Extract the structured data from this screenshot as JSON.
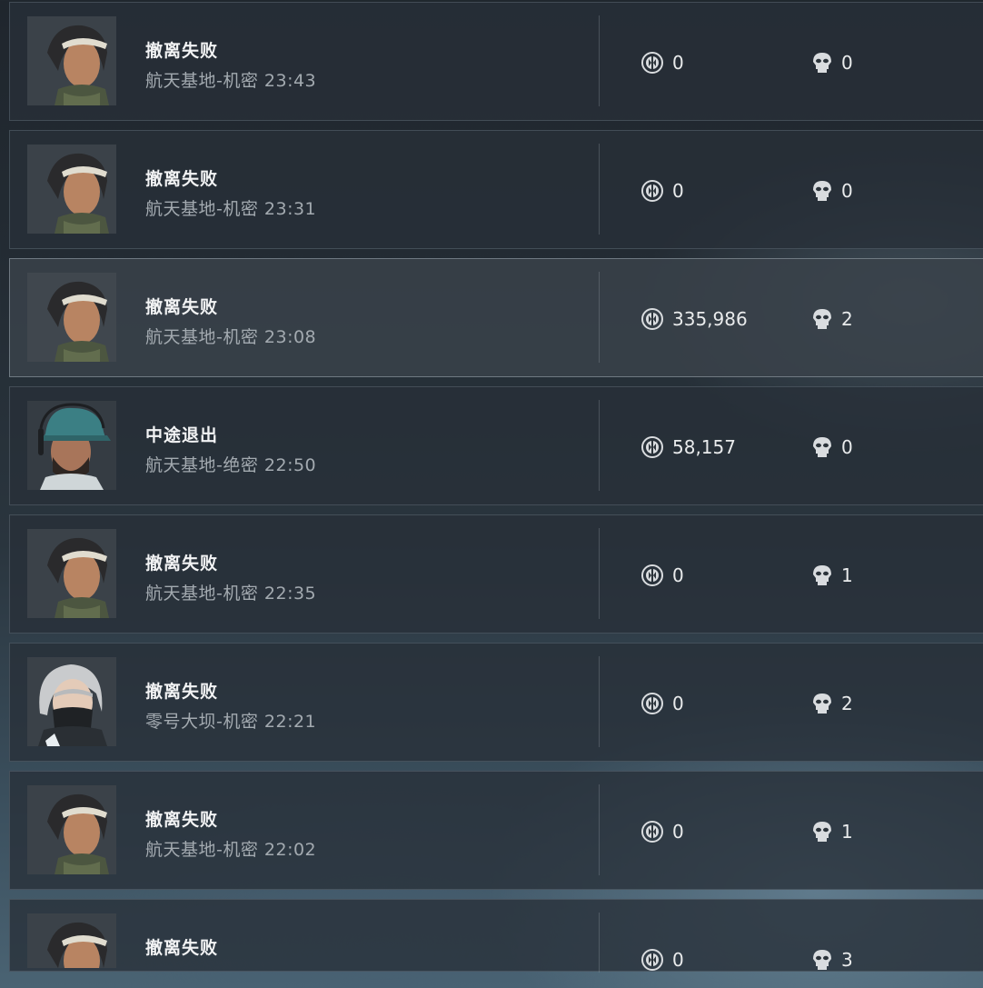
{
  "icons": {
    "currency": "hafcoin-icon",
    "kills": "skull-icon"
  },
  "colors": {
    "row_bg": "#283038",
    "row_selected_bg": "#3a424a",
    "title_text": "#f2f3f4",
    "subtitle_text": "#a3aab0"
  },
  "records": [
    {
      "operator": "female-operator-headband",
      "result": "撤离失败",
      "detail": "航天基地-机密 23:43",
      "money": "0",
      "kills": "0"
    },
    {
      "operator": "female-operator-headband",
      "result": "撤离失败",
      "detail": "航天基地-机密 23:31",
      "money": "0",
      "kills": "0"
    },
    {
      "operator": "female-operator-headband",
      "result": "撤离失败",
      "detail": "航天基地-机密 23:08",
      "money": "335,986",
      "kills": "2",
      "selected": true
    },
    {
      "operator": "male-operator-cap-headset",
      "result": "中途退出",
      "detail": "航天基地-绝密 22:50",
      "money": "58,157",
      "kills": "0"
    },
    {
      "operator": "female-operator-headband",
      "result": "撤离失败",
      "detail": "航天基地-机密 22:35",
      "money": "0",
      "kills": "1"
    },
    {
      "operator": "female-operator-masked-silver-hair",
      "result": "撤离失败",
      "detail": "零号大坝-机密 22:21",
      "money": "0",
      "kills": "2"
    },
    {
      "operator": "female-operator-headband",
      "result": "撤离失败",
      "detail": "航天基地-机密 22:02",
      "money": "0",
      "kills": "1"
    },
    {
      "operator": "female-operator-headband",
      "result": "撤离失败",
      "detail": "",
      "money": "0",
      "kills": "3"
    }
  ]
}
